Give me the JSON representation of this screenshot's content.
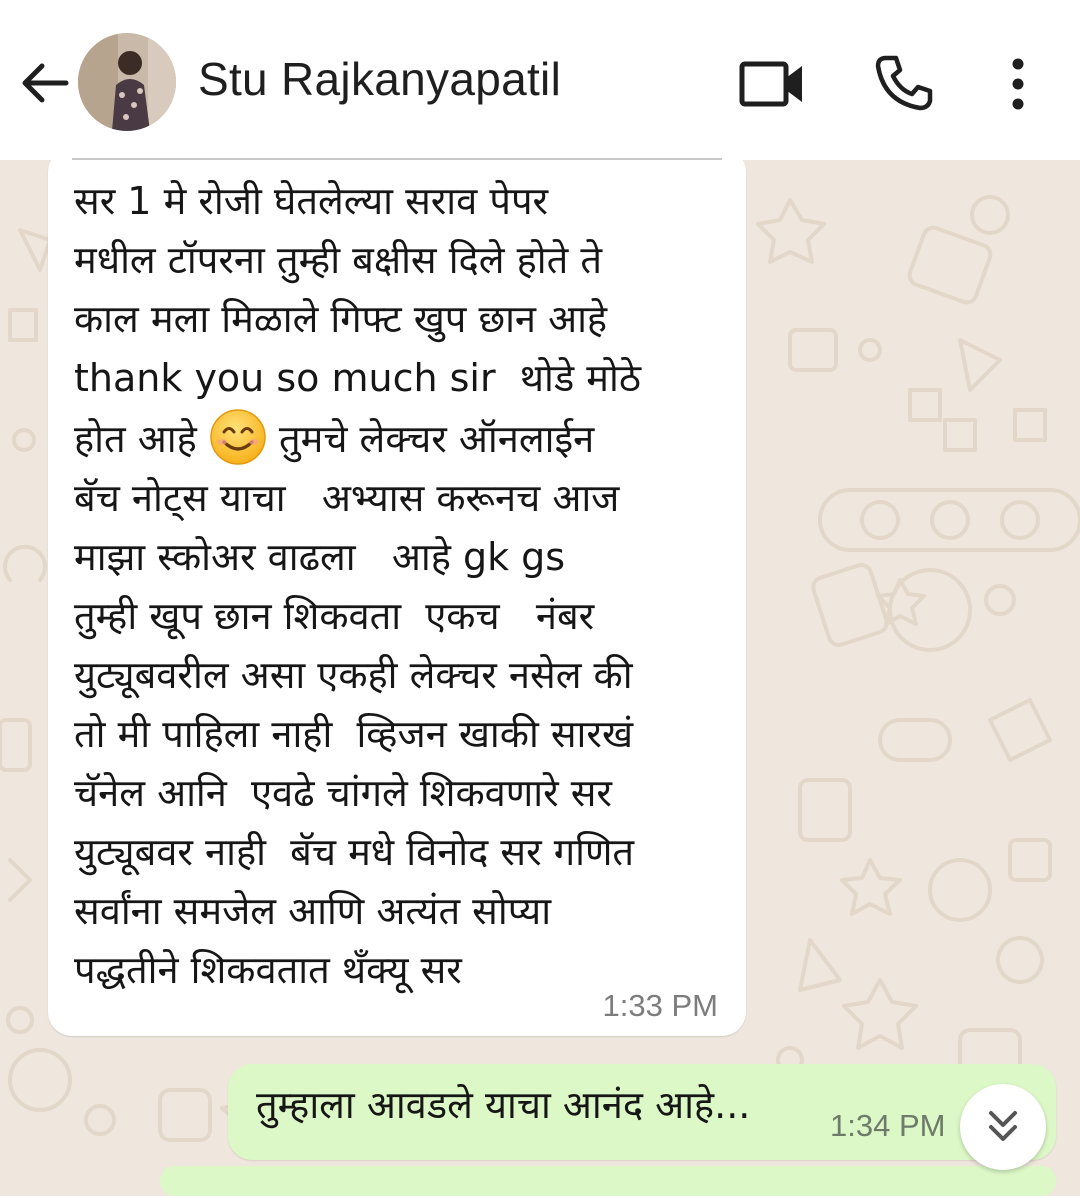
{
  "header": {
    "contact_name": "Stu Rajkanyapatil",
    "back_icon": "arrow-left-icon",
    "avatar": "contact-photo",
    "video_call_icon": "video-camera-icon",
    "voice_call_icon": "phone-icon",
    "menu_icon": "more-vertical-icon"
  },
  "messages": {
    "incoming": {
      "lines": [
        "सर 1 मे रोजी घेतलेल्या सराव पेपर",
        "मधील टॉपरना तुम्ही बक्षीस दिले होते ते",
        "काल मला मिळाले गिफ्ट खुप छान आहे",
        "thank you so much sir  थोडे मोठे",
        "होत आहे",
        "तुमचे लेक्चर ऑनलाईन",
        "बॅच नोट्स याचा   अभ्यास करूनच आज",
        "माझा स्कोअर वाढला   आहे gk gs",
        "तुम्ही खूप छान शिकवता  एकच   नंबर",
        "युट्यूबवरील असा एकही लेक्चर नसेल की",
        "तो मी पाहिला नाही  व्हिजन खाकी सारखं",
        "चॅनेल आनि  एवढे चांगले शिकवणारे सर",
        "युट्यूबवर नाही  बॅच मधे विनोद सर गणित",
        "सर्वांना समजेल आणि अत्यंत सोप्या",
        "पद्धतीने शिकवतात थँक्यू सर"
      ],
      "emoji": "smiling-face-emoji",
      "time": "1:33 PM"
    },
    "outgoing": {
      "text": "तुम्हाला आवडले याचा आनंद आहे...",
      "time": "1:34 PM"
    }
  },
  "scroll_button_icon": "double-chevron-down-icon",
  "colors": {
    "header_bg": "#ffffff",
    "chat_bg": "#efe7dd",
    "incoming_bubble": "#ffffff",
    "outgoing_bubble": "#dcf8c6",
    "timestamp": "#7d7d7d"
  }
}
